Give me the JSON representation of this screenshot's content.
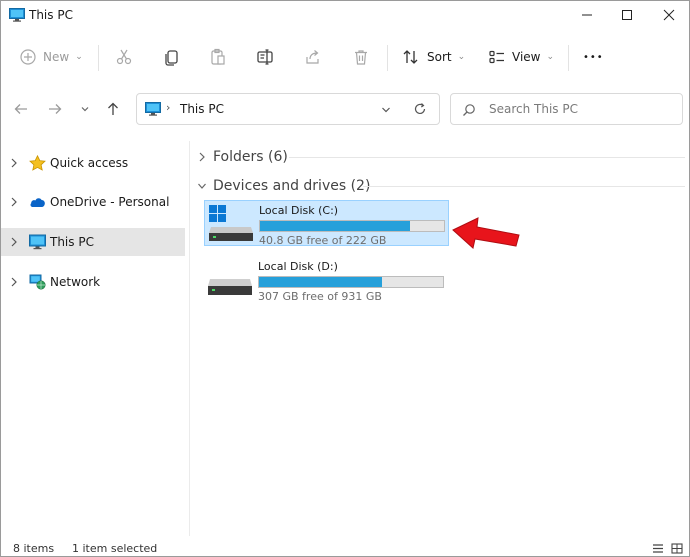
{
  "window": {
    "title": "This PC"
  },
  "toolbar": {
    "new_label": "New",
    "sort_label": "Sort",
    "view_label": "View",
    "more_label": "•••"
  },
  "address": {
    "location": "This PC"
  },
  "search": {
    "placeholder": "Search This PC"
  },
  "sidebar": {
    "items": [
      {
        "label": "Quick access",
        "icon": "star-icon"
      },
      {
        "label": "OneDrive - Personal",
        "icon": "cloud-icon"
      },
      {
        "label": "This PC",
        "icon": "monitor-icon",
        "selected": true
      },
      {
        "label": "Network",
        "icon": "network-icon"
      }
    ]
  },
  "content": {
    "folders_header": "Folders (6)",
    "devices_header": "Devices and drives (2)",
    "drives": [
      {
        "name": "Local Disk (C:)",
        "free": "40.8 GB free of 222 GB",
        "used_fraction": 0.816,
        "selected": true
      },
      {
        "name": "Local Disk (D:)",
        "free": "307 GB free of 931 GB",
        "used_fraction": 0.67,
        "selected": false
      }
    ]
  },
  "status": {
    "items_count": "8 items",
    "selection": "1 item selected"
  },
  "colors": {
    "accent": "#26a0da",
    "selection": "#cce8ff",
    "arrow": "#e8141b"
  }
}
